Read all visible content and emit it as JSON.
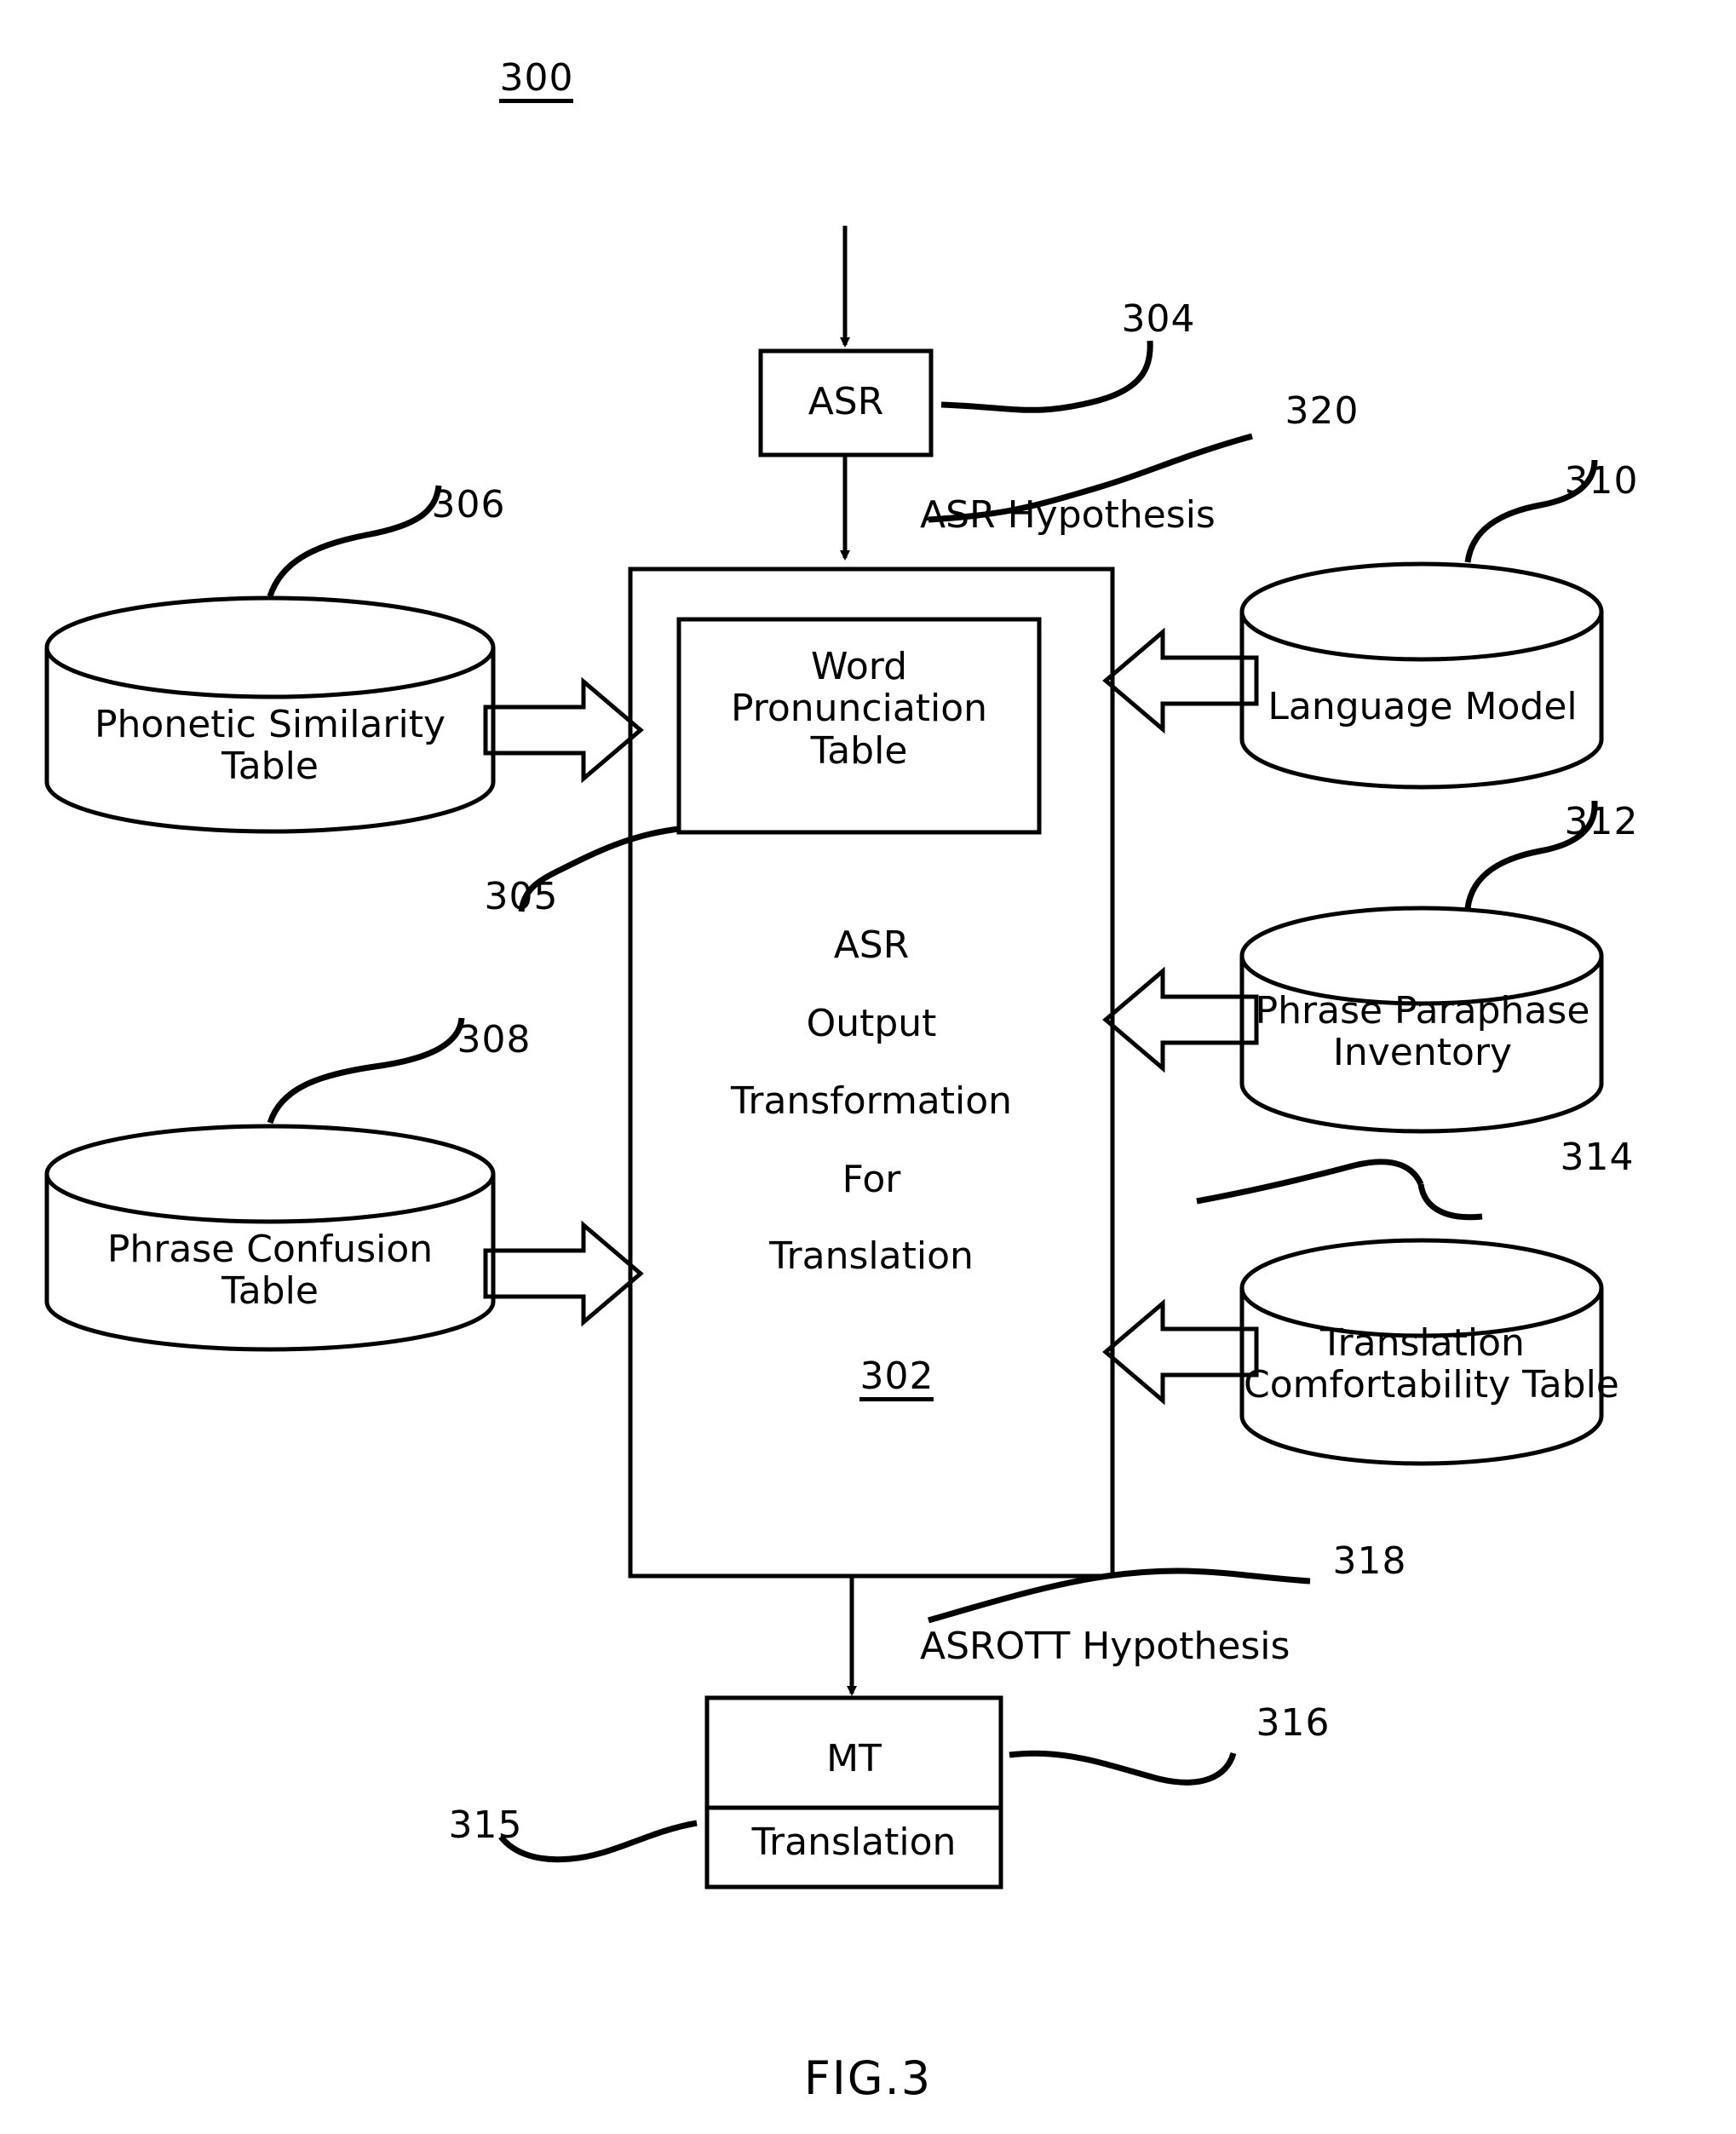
{
  "figure": {
    "number_label": "300",
    "caption": "FIG.3"
  },
  "blocks": {
    "asr": {
      "label": "ASR",
      "ref": "304"
    },
    "main": {
      "lines": [
        "ASR",
        "Output",
        "Transformation",
        "For",
        "Translation"
      ],
      "ref": "302"
    },
    "word_pronunciation_table": {
      "label": "Word\nPronunciation\nTable",
      "ref": "305"
    },
    "mt": {
      "label": "MT",
      "ref": "316"
    },
    "translation": {
      "label": "Translation",
      "ref": "315"
    }
  },
  "datastores": [
    {
      "label": "Phonetic Similarity\nTable",
      "ref": "306",
      "side": "left"
    },
    {
      "label": "Phrase Confusion\nTable",
      "ref": "308",
      "side": "left"
    },
    {
      "label": "Language Model",
      "ref": "310",
      "side": "right"
    },
    {
      "label": "Phrase Paraphase\nInventory",
      "ref": "312",
      "side": "right"
    },
    {
      "label": "Translation\nComfortability Table",
      "ref": "314",
      "side": "right"
    }
  ],
  "flow_labels": [
    {
      "text": "ASR Hypothesis",
      "ref": "320"
    },
    {
      "text": "ASROTT Hypothesis",
      "ref": "318"
    }
  ],
  "colors": {
    "ink": "#000000",
    "paper": "#ffffff"
  }
}
